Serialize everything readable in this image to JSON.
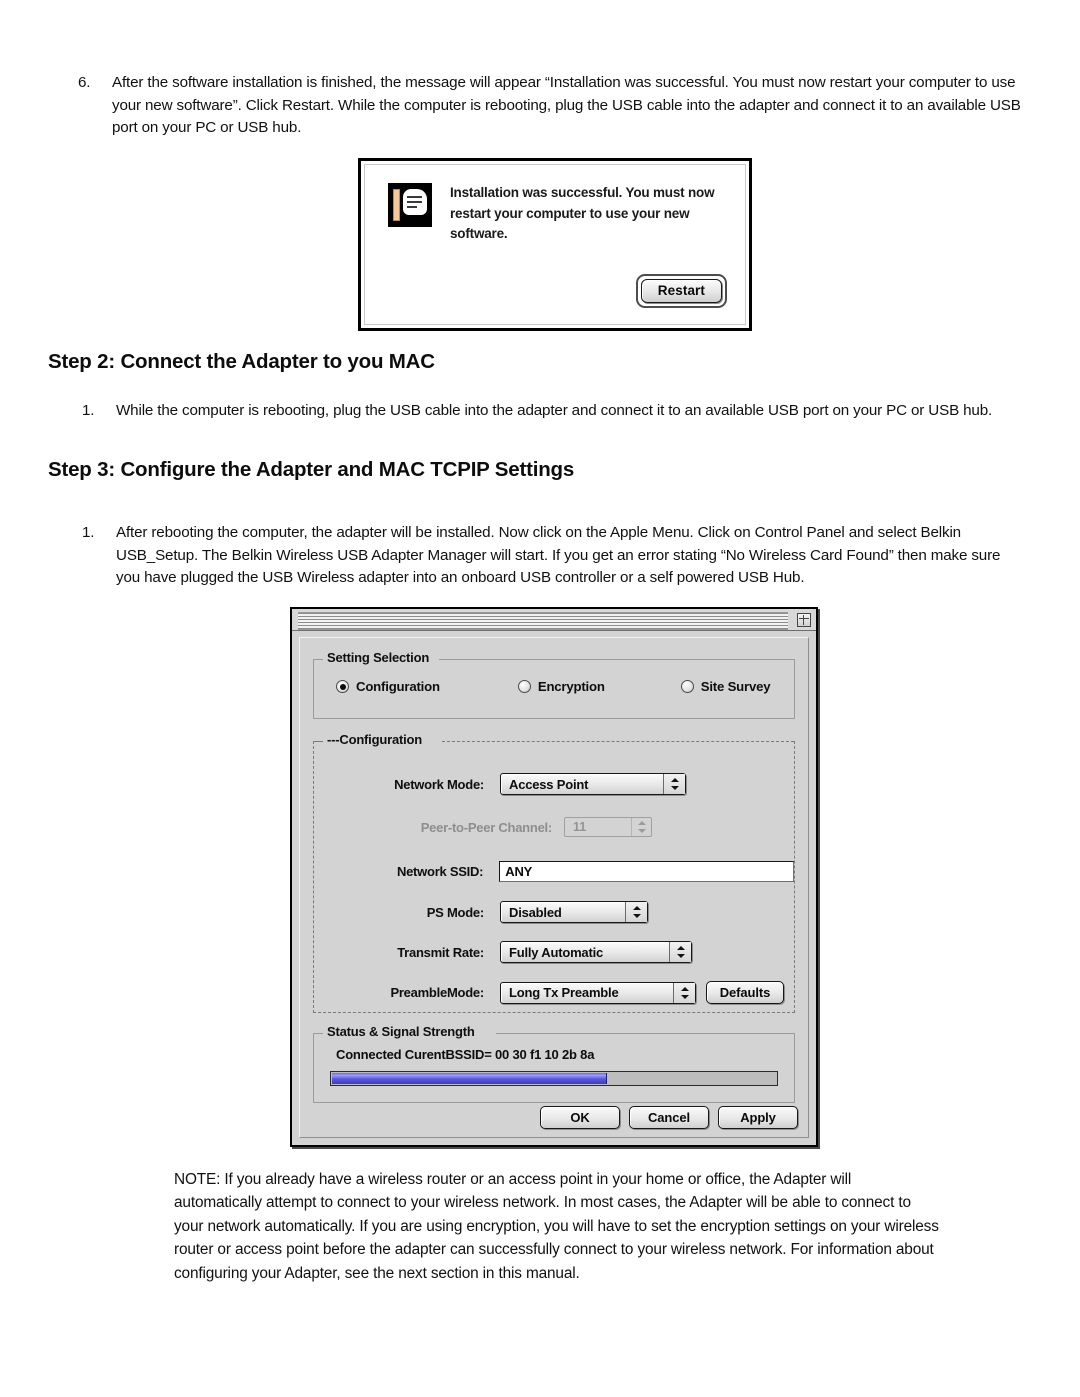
{
  "document": {
    "step1_item": {
      "number": "6.",
      "text": "After the software installation is finished, the message will appear “Installation was successful. You must now restart your computer to use your new software”.  Click Restart.   While the computer is rebooting, plug the USB cable into the adapter and connect it to an available USB port on your PC or USB hub."
    },
    "step2_heading": "Step 2: Connect the Adapter to you MAC",
    "step2_item": {
      "number": "1.",
      "text": "While the computer is rebooting, plug the USB cable into the adapter and connect it to an available USB port on your PC or USB hub."
    },
    "step3_heading": "Step 3: Configure the Adapter and MAC TCPIP Settings",
    "step3_item": {
      "number": "1.",
      "text": "After rebooting the computer, the adapter will be installed.  Now click on the Apple Menu. Click on Control Panel and select Belkin USB_Setup.  The Belkin Wireless USB Adapter Manager will start.   If you get an error stating “No Wireless Card Found” then make sure you have plugged the USB Wireless adapter into an onboard USB controller or a self powered USB Hub."
    },
    "note": "NOTE: If you already have a wireless router or an access point in your home or office, the Adapter will automatically attempt to connect to your wireless network. In most cases, the Adapter will be able to connect to your network automatically. If you are using encryption, you will have to set the encryption settings on your wireless router or access point before the adapter can successfully connect to your wireless network. For information about configuring your Adapter, see the next section in this manual."
  },
  "alert_dialog": {
    "icon": "installer-document-icon",
    "message": "Installation was successful. You must now restart your computer to use your new software.",
    "restart_label": "Restart"
  },
  "adapter_window": {
    "collapse_box_icon": "collapse-box-icon",
    "setting_selection": {
      "title": "Setting Selection",
      "options": [
        {
          "label": "Configuration",
          "selected": true
        },
        {
          "label": "Encryption",
          "selected": false
        },
        {
          "label": "Site Survey",
          "selected": false
        }
      ]
    },
    "configuration": {
      "title": "---Configuration",
      "network_mode": {
        "label": "Network Mode:",
        "value": "Access Point"
      },
      "peer_channel": {
        "label": "Peer-to-Peer Channel:",
        "value": "11",
        "disabled": true
      },
      "network_ssid": {
        "label": "Network SSID:",
        "value": "ANY"
      },
      "ps_mode": {
        "label": "PS Mode:",
        "value": "Disabled"
      },
      "transmit_rate": {
        "label": "Transmit Rate:",
        "value": "Fully Automatic"
      },
      "preamble_mode": {
        "label": "PreambleMode:",
        "value": "Long Tx Preamble"
      },
      "defaults_label": "Defaults"
    },
    "status": {
      "title": "Status & Signal Strength",
      "text": "Connected  CurentBSSID= 00 30 f1 10 2b 8a",
      "signal_percent": 62,
      "bar_color": "#5757dc"
    },
    "buttons": {
      "ok": "OK",
      "cancel": "Cancel",
      "apply": "Apply"
    }
  }
}
